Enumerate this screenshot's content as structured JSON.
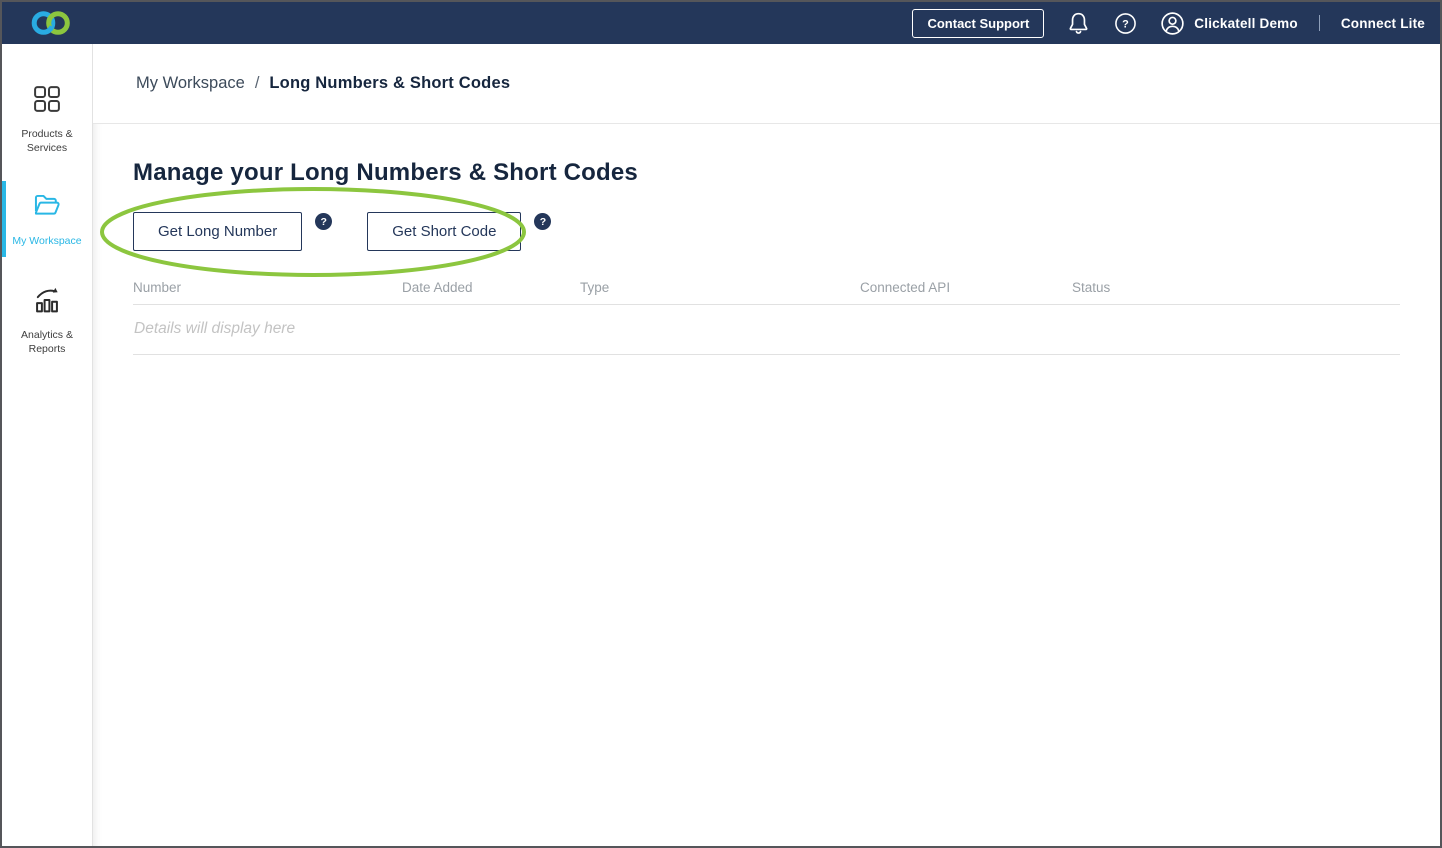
{
  "colors": {
    "navbar_navy": "#24375A",
    "accent_cyan": "#29B7E5",
    "logo_blue": "#29ABE2",
    "annotation_green": "#8CC63F"
  },
  "topbar": {
    "contact_support_label": "Contact Support",
    "account_name": "Clickatell Demo",
    "divider": "|",
    "product_name": "Connect Lite"
  },
  "sidebar": {
    "items": [
      {
        "label": "Products & Services",
        "active": false
      },
      {
        "label": "My Workspace",
        "active": true
      },
      {
        "label": "Analytics & Reports",
        "active": false
      }
    ]
  },
  "breadcrumb": {
    "parent": "My Workspace",
    "separator": "/",
    "current": "Long Numbers & Short Codes"
  },
  "main": {
    "heading": "Manage your Long Numbers & Short Codes",
    "actions": [
      {
        "label": "Get Long Number",
        "help_glyph": "?"
      },
      {
        "label": "Get Short Code",
        "help_glyph": "?"
      }
    ],
    "table": {
      "columns": [
        "Number",
        "Date Added",
        "Type",
        "Connected API",
        "Status"
      ],
      "empty_state": "Details will display here"
    },
    "annotation": {
      "shape": "ellipse",
      "color": "#8CC63F"
    }
  }
}
